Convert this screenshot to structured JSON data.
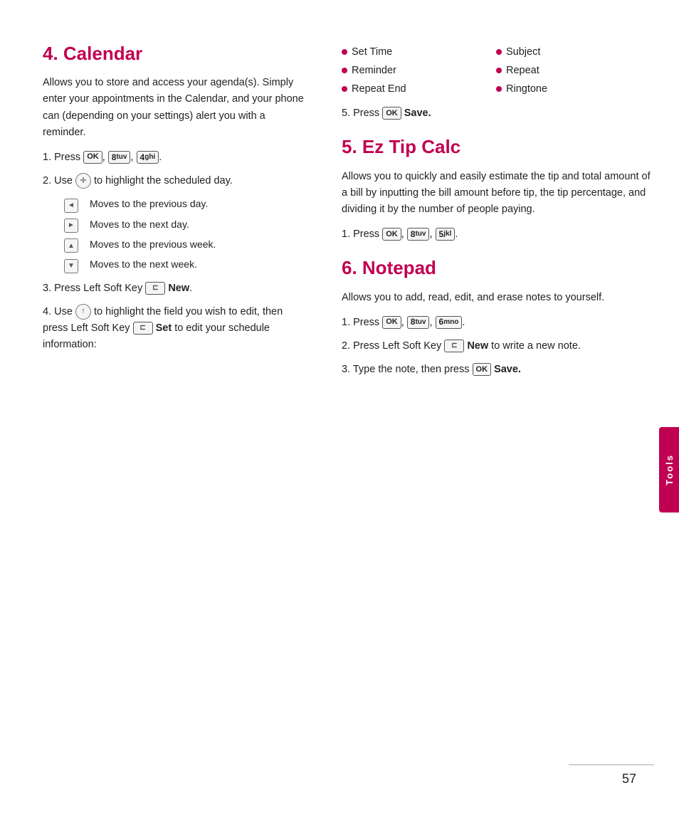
{
  "left": {
    "calendar": {
      "title": "4. Calendar",
      "body": "Allows you to store and access your agenda(s). Simply enter your appointments in the Calendar, and your phone can (depending on your settings) alert you with a reminder.",
      "step1_label": "1. Press",
      "step1_keys": [
        "OK",
        "8 tuv",
        "4 ghi"
      ],
      "step2_label": "2. Use",
      "step2_text": "to highlight the scheduled day.",
      "sub_bullets": [
        {
          "arrow": "◄",
          "text": "Moves to the previous day."
        },
        {
          "arrow": "►",
          "text": "Moves to the next day."
        },
        {
          "arrow": "▲",
          "text": "Moves to the previous week."
        },
        {
          "arrow": "▼",
          "text": "Moves to the next week."
        }
      ],
      "step3_label": "3. Press Left Soft Key",
      "step3_bold": "New",
      "step4_label": "4. Use",
      "step4_text": "to highlight the field you wish to edit, then press Left Soft Key",
      "step4_bold": "Set",
      "step4_suffix": "to edit your schedule information:"
    }
  },
  "right": {
    "bullet_col1": [
      "Set Time",
      "Reminder",
      "Repeat End"
    ],
    "bullet_col2": [
      "Subject",
      "Repeat",
      "Ringtone"
    ],
    "step5_label": "5. Press",
    "step5_bold": "Save.",
    "ez_tip": {
      "title": "5. Ez Tip Calc",
      "body": "Allows you to quickly and easily estimate the tip and total amount of a bill by inputting the bill amount before tip, the tip percentage, and dividing it by the number of people paying.",
      "step1_label": "1. Press",
      "step1_keys": [
        "OK",
        "8 tuv",
        "5 jkl"
      ]
    },
    "notepad": {
      "title": "6. Notepad",
      "body": "Allows you to add, read, edit, and erase notes to yourself.",
      "step1_label": "1. Press",
      "step1_keys": [
        "OK",
        "8 tuv",
        "6 mno"
      ],
      "step2_label": "2. Press Left Soft Key",
      "step2_bold": "New",
      "step2_suffix": "to write a new note.",
      "step3_label": "3. Type the note, then press",
      "step3_bold": "Save."
    }
  },
  "sidebar": {
    "label": "Tools"
  },
  "page_number": "57"
}
